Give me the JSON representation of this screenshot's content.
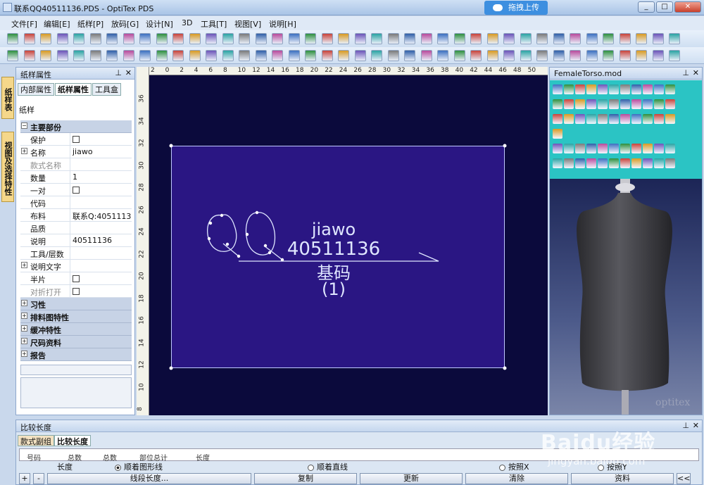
{
  "title_bar": {
    "title": "联系QQ40511136.PDS - OptiTex PDS",
    "upload_label": "拖拽上传"
  },
  "menu": [
    "文件[F]",
    "编辑[E]",
    "纸样[P]",
    "放码[G]",
    "设计[N]",
    "3D",
    "工具[T]",
    "视图[V]",
    "说明[H]"
  ],
  "left_tabs": [
    "纸样表",
    "视图及选择特性"
  ],
  "left_panel": {
    "title": "纸样属性",
    "tabs": [
      "内部属性",
      "纸样属性",
      "工具盒"
    ],
    "caption": "纸样",
    "section_main": "主要部份",
    "rows": [
      {
        "key": "保护",
        "value": "",
        "checkbox": true
      },
      {
        "key": "名称",
        "value": "jiawo",
        "expander": true
      },
      {
        "key": "款式名称",
        "value": "",
        "disabled": true
      },
      {
        "key": "数量",
        "value": "1"
      },
      {
        "key": "一对",
        "value": "",
        "checkbox": true
      },
      {
        "key": "代码",
        "value": ""
      },
      {
        "key": "布料",
        "value": "联系Q:40511136"
      },
      {
        "key": "品质",
        "value": ""
      },
      {
        "key": "说明",
        "value": "40511136"
      },
      {
        "key": "工具/层数",
        "value": ""
      },
      {
        "key": "说明文字",
        "value": "",
        "expander": true
      },
      {
        "key": "半片",
        "value": "",
        "checkbox": true
      },
      {
        "key": "对折打开",
        "value": "",
        "checkbox": true,
        "disabled": true
      }
    ],
    "sections": [
      "习性",
      "排料图特性",
      "缓冲特性",
      "尺码资料",
      "报告"
    ]
  },
  "ruler": {
    "h_ticks": [
      "2",
      "0",
      "2",
      "4",
      "6",
      "8",
      "10",
      "12",
      "14",
      "16",
      "18",
      "20",
      "22",
      "24",
      "26",
      "28",
      "30",
      "32",
      "34",
      "36",
      "38",
      "40",
      "42",
      "44",
      "46",
      "48",
      "50"
    ],
    "v_ticks": [
      "36",
      "34",
      "32",
      "30",
      "28",
      "26",
      "24",
      "22",
      "20",
      "18",
      "16",
      "14",
      "12",
      "10",
      "8"
    ]
  },
  "piece": {
    "handwriting": "QQ",
    "line1": "jiawo",
    "line2": "40511136",
    "line3": "基码",
    "line4": "(1)"
  },
  "right_panel": {
    "title": "FemaleTorso.mod",
    "brand": "optitex"
  },
  "bottom_panel": {
    "title": "比较长度",
    "tabs": [
      "款式副组",
      "比较长度"
    ],
    "table_headers": [
      "号码",
      "总数",
      "总数",
      "部位总计",
      "长度"
    ],
    "length_label": "长度",
    "radios": [
      {
        "label": "顺着图形线",
        "selected": true
      },
      {
        "label": "顺着直线",
        "selected": false
      },
      {
        "label": "按照X",
        "selected": false
      },
      {
        "label": "按照Y",
        "selected": false
      }
    ],
    "buttons": [
      "+",
      "-",
      "线段长度...",
      "复制",
      "更新",
      "清除",
      "资料",
      "<<"
    ]
  },
  "watermark": {
    "brand": "Baidu经验",
    "url": "jingyan.baidu.com"
  }
}
